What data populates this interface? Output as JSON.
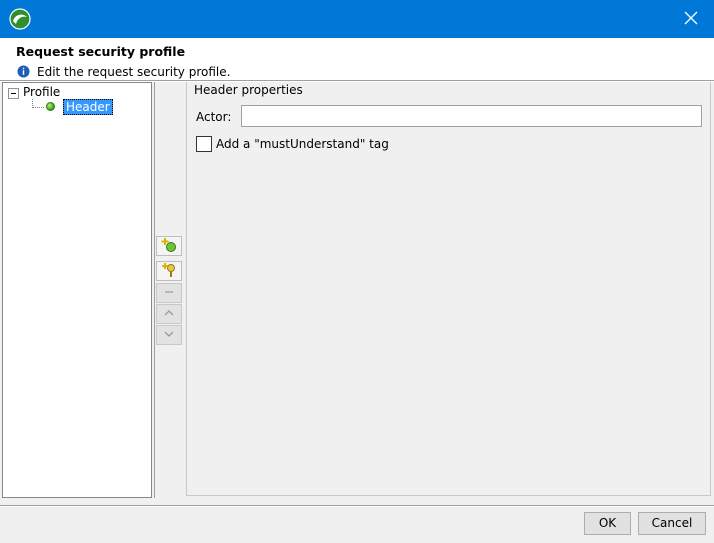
{
  "window": {
    "accent_color": "#0078d7",
    "app_icon": "app-logo-icon",
    "close_icon": "close-icon"
  },
  "header": {
    "title": "Request security profile",
    "description": "Edit the request security profile."
  },
  "tree": {
    "root_label": "Profile",
    "root_expanded": true,
    "children": [
      {
        "label": "Header",
        "selected": true,
        "icon": "green-dot-icon"
      }
    ]
  },
  "toolbar": {
    "buttons": [
      {
        "name": "add-item-button",
        "icon": "add-icon",
        "enabled": true
      },
      {
        "name": "add-key-button",
        "icon": "key-add-icon",
        "enabled": true
      },
      {
        "name": "remove-button",
        "icon": "minus-icon",
        "enabled": false
      },
      {
        "name": "move-up-button",
        "icon": "chevron-up-icon",
        "enabled": false
      },
      {
        "name": "move-down-button",
        "icon": "chevron-down-icon",
        "enabled": false
      }
    ]
  },
  "properties": {
    "group_title": "Header properties",
    "actor_label": "Actor:",
    "actor_value": "",
    "must_understand_label": "Add a \"mustUnderstand\" tag",
    "must_understand_checked": false
  },
  "footer": {
    "ok_label": "OK",
    "cancel_label": "Cancel"
  }
}
